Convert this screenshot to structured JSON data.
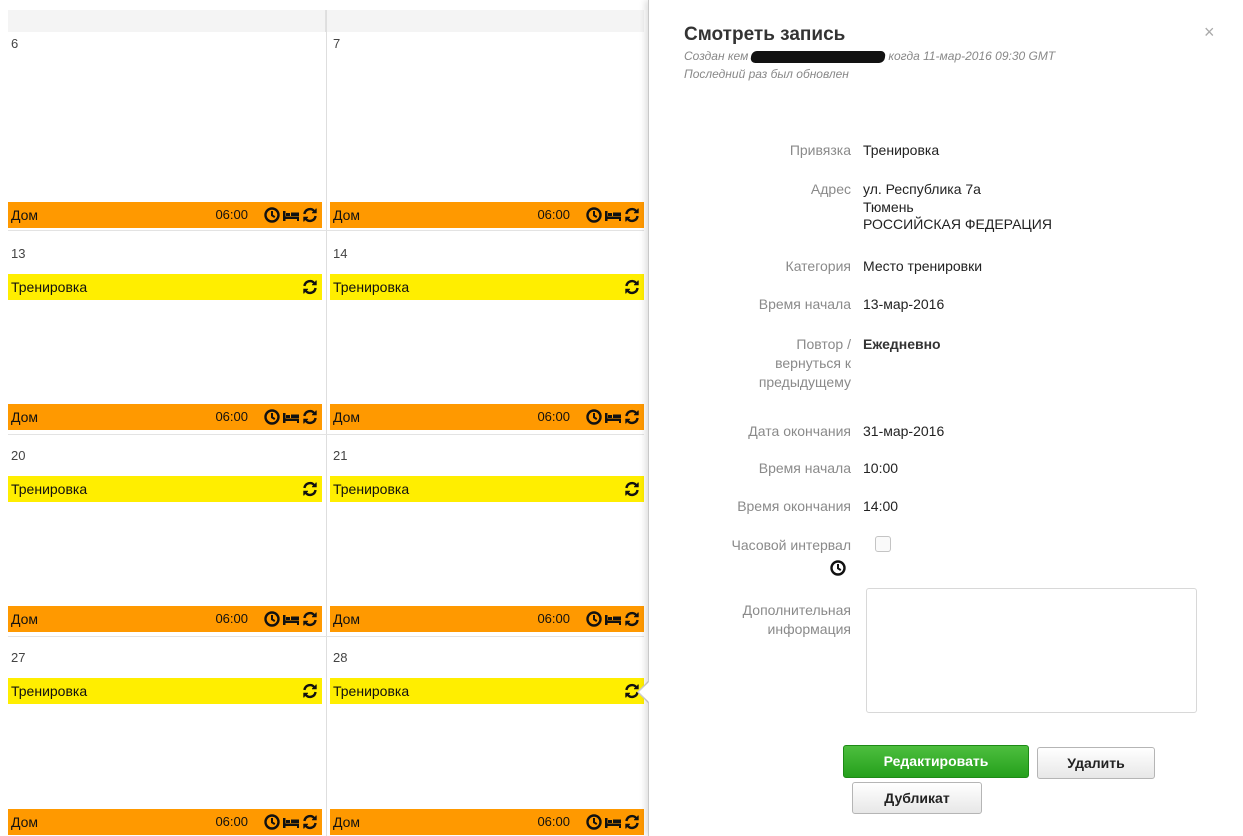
{
  "calendar": {
    "top_row": [
      {
        "day": "6",
        "bottom": {
          "label": "Дом",
          "time": "06:00"
        }
      },
      {
        "day": "7",
        "bottom": {
          "label": "Дом",
          "time": "06:00"
        }
      }
    ],
    "rows": [
      {
        "cells": [
          {
            "day": "13",
            "top": {
              "label": "Тренировка"
            },
            "bottom": {
              "label": "Дом",
              "time": "06:00"
            }
          },
          {
            "day": "14",
            "top": {
              "label": "Тренировка"
            },
            "bottom": {
              "label": "Дом",
              "time": "06:00"
            }
          }
        ]
      },
      {
        "cells": [
          {
            "day": "20",
            "top": {
              "label": "Тренировка"
            },
            "bottom": {
              "label": "Дом",
              "time": "06:00"
            }
          },
          {
            "day": "21",
            "top": {
              "label": "Тренировка"
            },
            "bottom": {
              "label": "Дом",
              "time": "06:00"
            }
          }
        ]
      },
      {
        "cells": [
          {
            "day": "27",
            "top": {
              "label": "Тренировка"
            },
            "bottom": {
              "label": "Дом",
              "time": "06:00"
            }
          },
          {
            "day": "28",
            "top": {
              "label": "Тренировка"
            },
            "bottom": {
              "label": "Дом",
              "time": "06:00"
            }
          }
        ]
      }
    ],
    "colors": {
      "home": "#ff9900",
      "training": "#ffee00"
    },
    "icons": [
      "clock-icon",
      "bed-icon",
      "repeat-icon"
    ]
  },
  "panel": {
    "title": "Смотреть запись",
    "close": "×",
    "created_prefix": "Создан кем",
    "created_suffix": "когда 11-мар-2016 09:30 GMT",
    "updated": "Последний раз был обновлен",
    "fields": {
      "binding": {
        "label": "Привязка",
        "value": "Тренировка"
      },
      "address": {
        "label": "Адрес",
        "line1": "ул. Республика 7а",
        "line2": "Тюмень",
        "line3": "РОССИЙСКАЯ ФЕДЕРАЦИЯ"
      },
      "category": {
        "label": "Категория",
        "value": "Место тренировки"
      },
      "start_date": {
        "label": "Время начала",
        "value": "13-мар-2016"
      },
      "repeat": {
        "label1": "Повтор /",
        "label2": "вернуться к",
        "label3": "предыдущему",
        "value": "Ежедневно"
      },
      "end_date": {
        "label": "Дата окончания",
        "value": "31-мар-2016"
      },
      "start_time": {
        "label": "Время начала",
        "value": "10:00"
      },
      "end_time": {
        "label": "Время окончания",
        "value": "14:00"
      },
      "timezone": {
        "label": "Часовой интервал",
        "checked": false
      },
      "extra": {
        "label1": "Дополнительная",
        "label2": "информация",
        "value": ""
      }
    },
    "buttons": {
      "edit": "Редактировать",
      "delete": "Удалить",
      "duplicate": "Дубликат"
    },
    "colors": {
      "edit_button": "#2aa51f"
    }
  }
}
